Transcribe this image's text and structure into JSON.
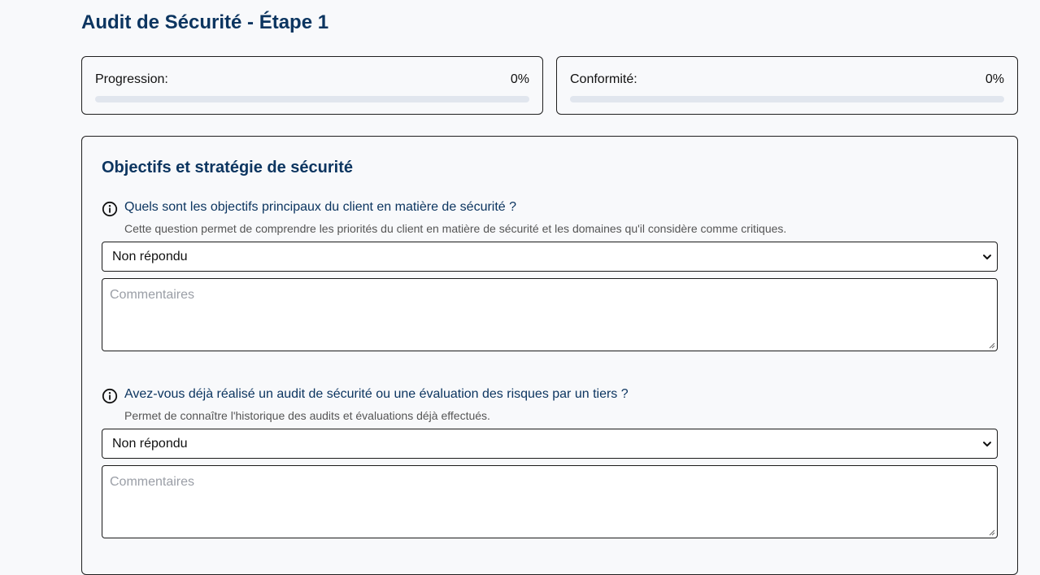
{
  "page": {
    "title": "Audit de Sécurité - Étape 1"
  },
  "stats": {
    "progression": {
      "label": "Progression:",
      "value": "0%",
      "fraction": 0
    },
    "conformite": {
      "label": "Conformité:",
      "value": "0%",
      "fraction": 0
    }
  },
  "section": {
    "title": "Objectifs et stratégie de sécurité",
    "questions": [
      {
        "icon": "info-icon",
        "text": "Quels sont les objectifs principaux du client en matière de sécurité ?",
        "help": "Cette question permet de comprendre les priorités du client en matière de sécurité et les domaines qu'il considère comme critiques.",
        "selected": "Non répondu",
        "comment_placeholder": "Commentaires"
      },
      {
        "icon": "info-icon",
        "text": "Avez-vous déjà réalisé un audit de sécurité ou une évaluation des risques par un tiers ?",
        "help": "Permet de connaître l'historique des audits et évaluations déjà effectués.",
        "selected": "Non répondu",
        "comment_placeholder": "Commentaires"
      }
    ]
  },
  "colors": {
    "accent": "#0c3560",
    "track": "#e1e6ee",
    "background": "#f8f9fb"
  }
}
